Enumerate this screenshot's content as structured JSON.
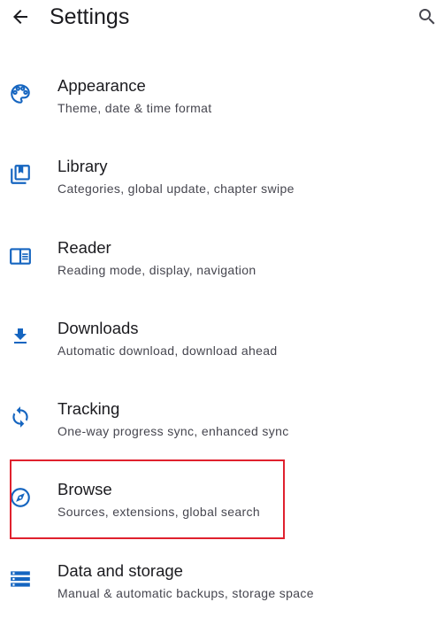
{
  "header": {
    "title": "Settings",
    "back_icon": "arrow-back-icon",
    "search_icon": "search-icon"
  },
  "colors": {
    "accent": "#1565c0",
    "highlight": "#e0212e"
  },
  "settings": [
    {
      "title": "Appearance",
      "subtitle": "Theme, date & time format",
      "icon": "palette-icon"
    },
    {
      "title": "Library",
      "subtitle": "Categories, global update, chapter swipe",
      "icon": "library-icon"
    },
    {
      "title": "Reader",
      "subtitle": "Reading mode, display, navigation",
      "icon": "reader-icon"
    },
    {
      "title": "Downloads",
      "subtitle": "Automatic download, download ahead",
      "icon": "download-icon"
    },
    {
      "title": "Tracking",
      "subtitle": "One-way progress sync, enhanced sync",
      "icon": "sync-icon"
    },
    {
      "title": "Browse",
      "subtitle": "Sources, extensions, global search",
      "icon": "compass-icon"
    },
    {
      "title": "Data and storage",
      "subtitle": "Manual & automatic backups, storage space",
      "icon": "storage-icon"
    }
  ]
}
